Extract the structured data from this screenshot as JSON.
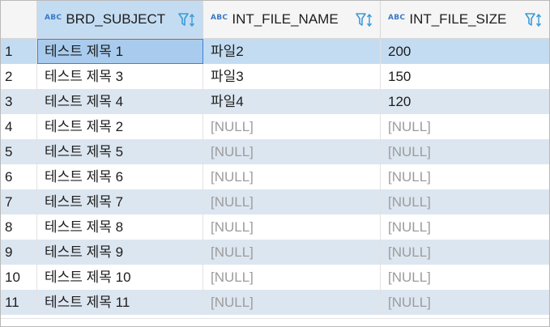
{
  "columns": [
    {
      "type_badge": "ABC",
      "name": "BRD_SUBJECT"
    },
    {
      "type_badge": "ABC",
      "name": "INT_FILE_NAME"
    },
    {
      "type_badge": "ABC",
      "name": "INT_FILE_SIZE"
    }
  ],
  "rows": [
    {
      "num": "1",
      "cells": [
        "테스트 제목 1",
        "파일2",
        "200"
      ],
      "nulls": [
        false,
        false,
        false
      ]
    },
    {
      "num": "2",
      "cells": [
        "테스트 제목 3",
        "파일3",
        "150"
      ],
      "nulls": [
        false,
        false,
        false
      ]
    },
    {
      "num": "3",
      "cells": [
        "테스트 제목 4",
        "파일4",
        "120"
      ],
      "nulls": [
        false,
        false,
        false
      ]
    },
    {
      "num": "4",
      "cells": [
        "테스트 제목 2",
        "[NULL]",
        "[NULL]"
      ],
      "nulls": [
        false,
        true,
        true
      ]
    },
    {
      "num": "5",
      "cells": [
        "테스트 제목 5",
        "[NULL]",
        "[NULL]"
      ],
      "nulls": [
        false,
        true,
        true
      ]
    },
    {
      "num": "6",
      "cells": [
        "테스트 제목 6",
        "[NULL]",
        "[NULL]"
      ],
      "nulls": [
        false,
        true,
        true
      ]
    },
    {
      "num": "7",
      "cells": [
        "테스트 제목 7",
        "[NULL]",
        "[NULL]"
      ],
      "nulls": [
        false,
        true,
        true
      ]
    },
    {
      "num": "8",
      "cells": [
        "테스트 제목 8",
        "[NULL]",
        "[NULL]"
      ],
      "nulls": [
        false,
        true,
        true
      ]
    },
    {
      "num": "9",
      "cells": [
        "테스트 제목 9",
        "[NULL]",
        "[NULL]"
      ],
      "nulls": [
        false,
        true,
        true
      ]
    },
    {
      "num": "10",
      "cells": [
        "테스트 제목 10",
        "[NULL]",
        "[NULL]"
      ],
      "nulls": [
        false,
        true,
        true
      ]
    },
    {
      "num": "11",
      "cells": [
        "테스트 제목 11",
        "[NULL]",
        "[NULL]"
      ],
      "nulls": [
        false,
        true,
        true
      ]
    }
  ],
  "colors": {
    "header_bg": "#f5f5f5",
    "selected_header_bg": "#c3dcf2",
    "alt_row_bg": "#dce6f0",
    "selected_row_bg": "#c3dcf2",
    "focus_border": "#3f7fd6",
    "null_text": "#9c9c9c",
    "type_badge": "#3a78c8",
    "filter_icon": "#3a9bd8"
  },
  "icons": {
    "filter": "funnel-filter-icon",
    "sort": "sort-arrows-icon"
  },
  "selection": {
    "row": 1,
    "column": "BRD_SUBJECT"
  }
}
